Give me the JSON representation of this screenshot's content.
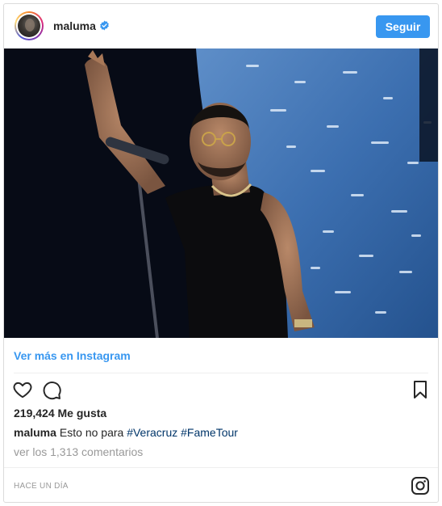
{
  "header": {
    "username": "maluma",
    "follow_label": "Seguir"
  },
  "post": {
    "view_more_label": "Ver más en Instagram",
    "likes_count": "219,424",
    "likes_label": "Me gusta",
    "caption": {
      "username": "maluma",
      "text": "Esto no para",
      "hashtags": [
        "#Veracruz",
        "#FameTour"
      ]
    },
    "comments_link": "ver los 1,313 comentarios",
    "timestamp": "HACE UN DÍA"
  },
  "icons": {
    "verified": "verified-badge-icon",
    "like": "heart-icon",
    "comment": "comment-icon",
    "save": "bookmark-icon",
    "brand": "instagram-icon"
  },
  "colors": {
    "accent": "#3897f0",
    "hashtag": "#003569",
    "muted": "#999999",
    "text": "#262626",
    "border": "#dbdbdb"
  }
}
